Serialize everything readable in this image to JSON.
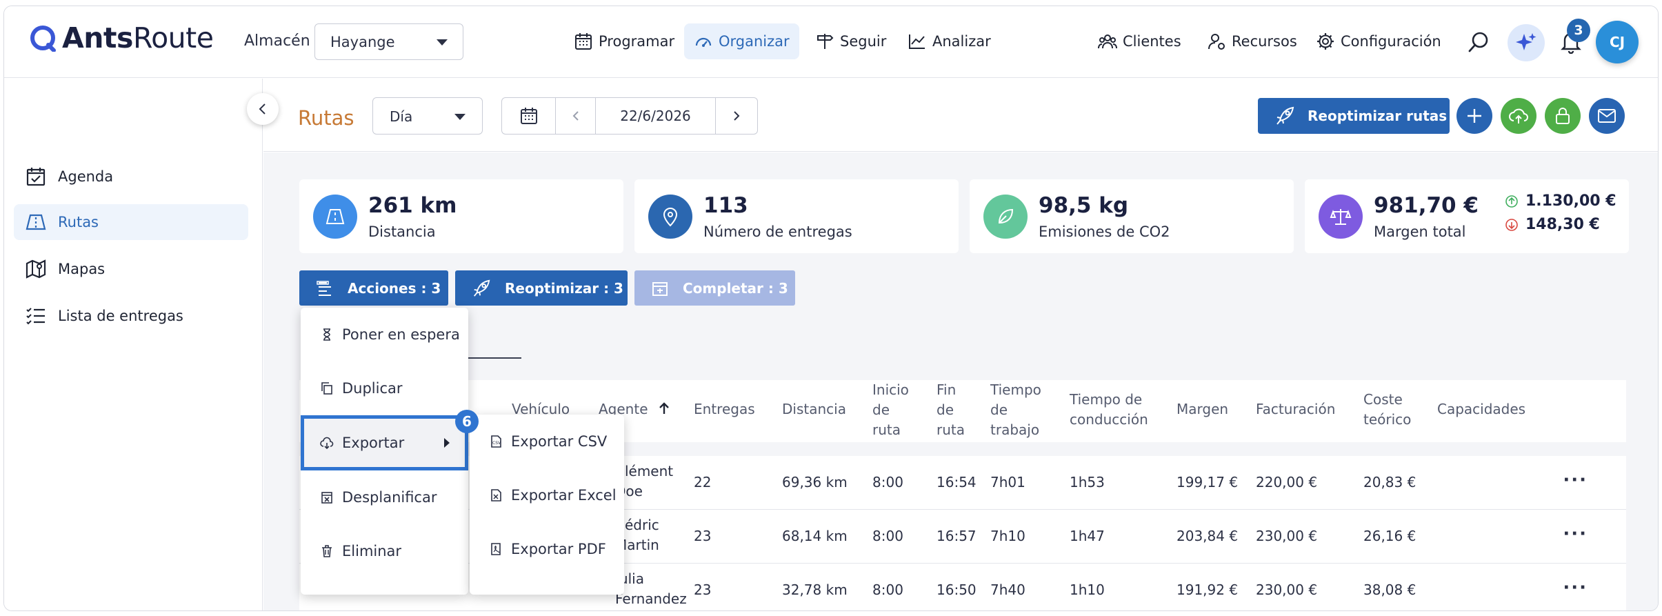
{
  "app": {
    "logo_bold": "Ants",
    "logo_light": "Route"
  },
  "header": {
    "almacen_label": "Almacén",
    "almacen_value": "Hayange",
    "nav": [
      {
        "label": "Programar",
        "icon": "calendar-icon"
      },
      {
        "label": "Organizar",
        "icon": "gauge-icon"
      },
      {
        "label": "Seguir",
        "icon": "signpost-icon"
      },
      {
        "label": "Analizar",
        "icon": "chart-icon"
      }
    ],
    "nav_right": [
      {
        "label": "Clientes",
        "icon": "clients-icon"
      },
      {
        "label": "Recursos",
        "icon": "resources-icon"
      },
      {
        "label": "Configuración",
        "icon": "gear-icon"
      }
    ],
    "notifications_count": "3",
    "user_initials": "CJ"
  },
  "sidebar": {
    "items": [
      {
        "label": "Agenda",
        "icon": "calendar-check-icon"
      },
      {
        "label": "Rutas",
        "icon": "road-icon"
      },
      {
        "label": "Mapas",
        "icon": "map-icon"
      },
      {
        "label": "Lista de entregas",
        "icon": "list-icon"
      }
    ]
  },
  "toolbar": {
    "title": "Rutas",
    "view": "Día",
    "date": "22/6/2026",
    "reoptimize_label": "Reoptimizar rutas"
  },
  "kpis": [
    {
      "value": "261 km",
      "label": "Distancia",
      "color": "#3f8ee8"
    },
    {
      "value": "113",
      "label": "Número de entregas",
      "color": "#2b67b0"
    },
    {
      "value": "98,5 kg",
      "label": "Emisiones de CO2",
      "color": "#63c79b"
    },
    {
      "value": "981,70 €",
      "label": "Margen total",
      "color": "#7e5be0",
      "up": "1.130,00 €",
      "down": "148,30 €"
    }
  ],
  "actions": {
    "acciones": "Acciones : 3",
    "reoptimizar": "Reoptimizar : 3",
    "completar": "Completar : 3"
  },
  "table": {
    "headers": {
      "vehiculo": "Vehículo",
      "agente": "Agente",
      "entregas": "Entregas",
      "distancia": "Distancia",
      "inicio": [
        "Inicio",
        "de",
        "ruta"
      ],
      "fin": [
        "Fin",
        "de",
        "ruta"
      ],
      "tiempo_trabajo": [
        "Tiempo",
        "de",
        "trabajo"
      ],
      "tiempo_conduccion": [
        "Tiempo de",
        "conducción"
      ],
      "margen": "Margen",
      "facturacion": "Facturación",
      "coste": [
        "Coste",
        "teórico"
      ],
      "capacidades": "Capacidades"
    },
    "rows": [
      {
        "agent": [
          "Clément",
          "Doe"
        ],
        "entregas": "22",
        "distancia": "69,36 km",
        "inicio": "8:00",
        "fin": "16:54",
        "trabajo": "7h01",
        "conduccion": "1h53",
        "margen": "199,17 €",
        "facturacion": "220,00 €",
        "coste": "20,83 €"
      },
      {
        "agent": [
          "Cédric",
          "Martin"
        ],
        "entregas": "23",
        "distancia": "68,14 km",
        "inicio": "8:00",
        "fin": "16:57",
        "trabajo": "7h10",
        "conduccion": "1h47",
        "margen": "203,84 €",
        "facturacion": "230,00 €",
        "coste": "26,16 €"
      },
      {
        "agent": [
          "Julia",
          "Fernandez"
        ],
        "entregas": "23",
        "distancia": "32,78 km",
        "inicio": "8:00",
        "fin": "16:50",
        "trabajo": "7h40",
        "conduccion": "1h10",
        "margen": "191,92 €",
        "facturacion": "230,00 €",
        "coste": "38,08 €"
      }
    ]
  },
  "menu": {
    "items": [
      "Poner en espera",
      "Duplicar",
      "Exportar",
      "Desplanificar",
      "Eliminar"
    ],
    "selected_badge": "6",
    "submenu": [
      "Exportar CSV",
      "Exportar Excel",
      "Exportar PDF"
    ]
  }
}
